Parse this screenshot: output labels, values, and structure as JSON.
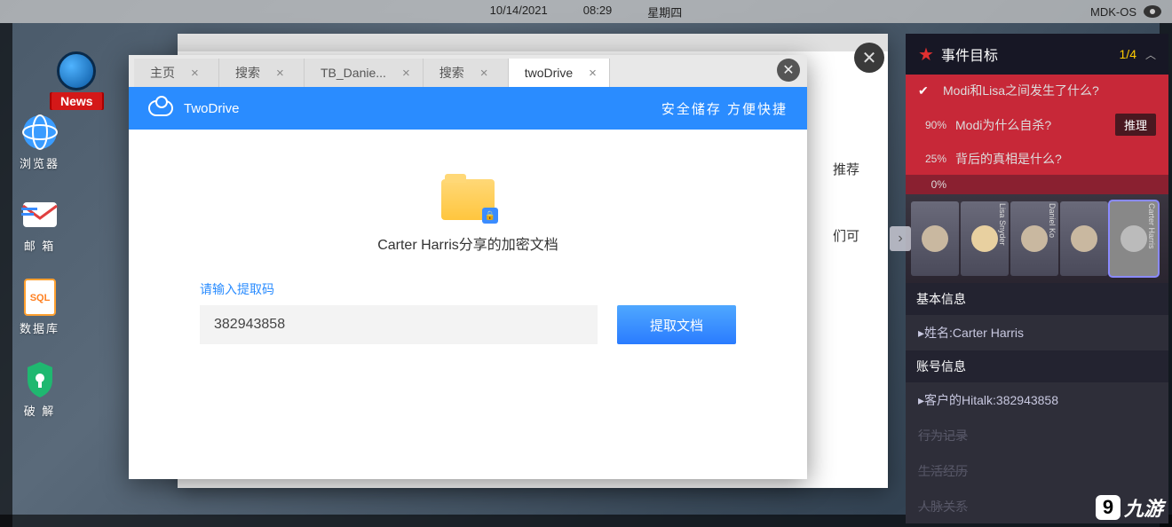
{
  "status": {
    "date": "10/14/2021",
    "time": "08:29",
    "weekday": "星期四",
    "os": "MDK-OS"
  },
  "news": {
    "label": "News"
  },
  "desktop": {
    "browser": "浏览器",
    "mail": "邮 箱",
    "database": "数据库",
    "crack": "破 解"
  },
  "bg": {
    "rec": "推荐",
    "can": "们可"
  },
  "modal": {
    "tabs": [
      "主页",
      "搜索",
      "TB_Danie...",
      "搜索",
      "twoDrive"
    ],
    "brand": "TwoDrive",
    "slogan": "安全储存  方便快捷",
    "doc_title": "Carter Harris分享的加密文档",
    "prompt": "请输入提取码",
    "code_value": "382943858",
    "extract": "提取文档"
  },
  "rpanel": {
    "title": "事件目标",
    "progress": "1/4",
    "goals": [
      {
        "done": true,
        "pct": "",
        "text": "Modi和Lisa之间发生了什么?"
      },
      {
        "done": false,
        "pct": "90%",
        "text": "Modi为什么自杀?",
        "btn": "推理"
      },
      {
        "done": false,
        "pct": "25%",
        "text": "背后的真相是什么?"
      },
      {
        "done": false,
        "pct": "0%",
        "text": ""
      }
    ],
    "portraits": [
      "",
      "Lisa Snyder",
      "Daniel Ko",
      "",
      "Carter Harris"
    ],
    "info": {
      "basic_h": "基本信息",
      "name": "▸姓名:Carter Harris",
      "account_h": "账号信息",
      "hitalk": "▸客户的Hitalk:382943858",
      "dim1": "行为记录",
      "dim2": "生活经历",
      "dim3": "人脉关系"
    }
  },
  "watermark": "九游"
}
